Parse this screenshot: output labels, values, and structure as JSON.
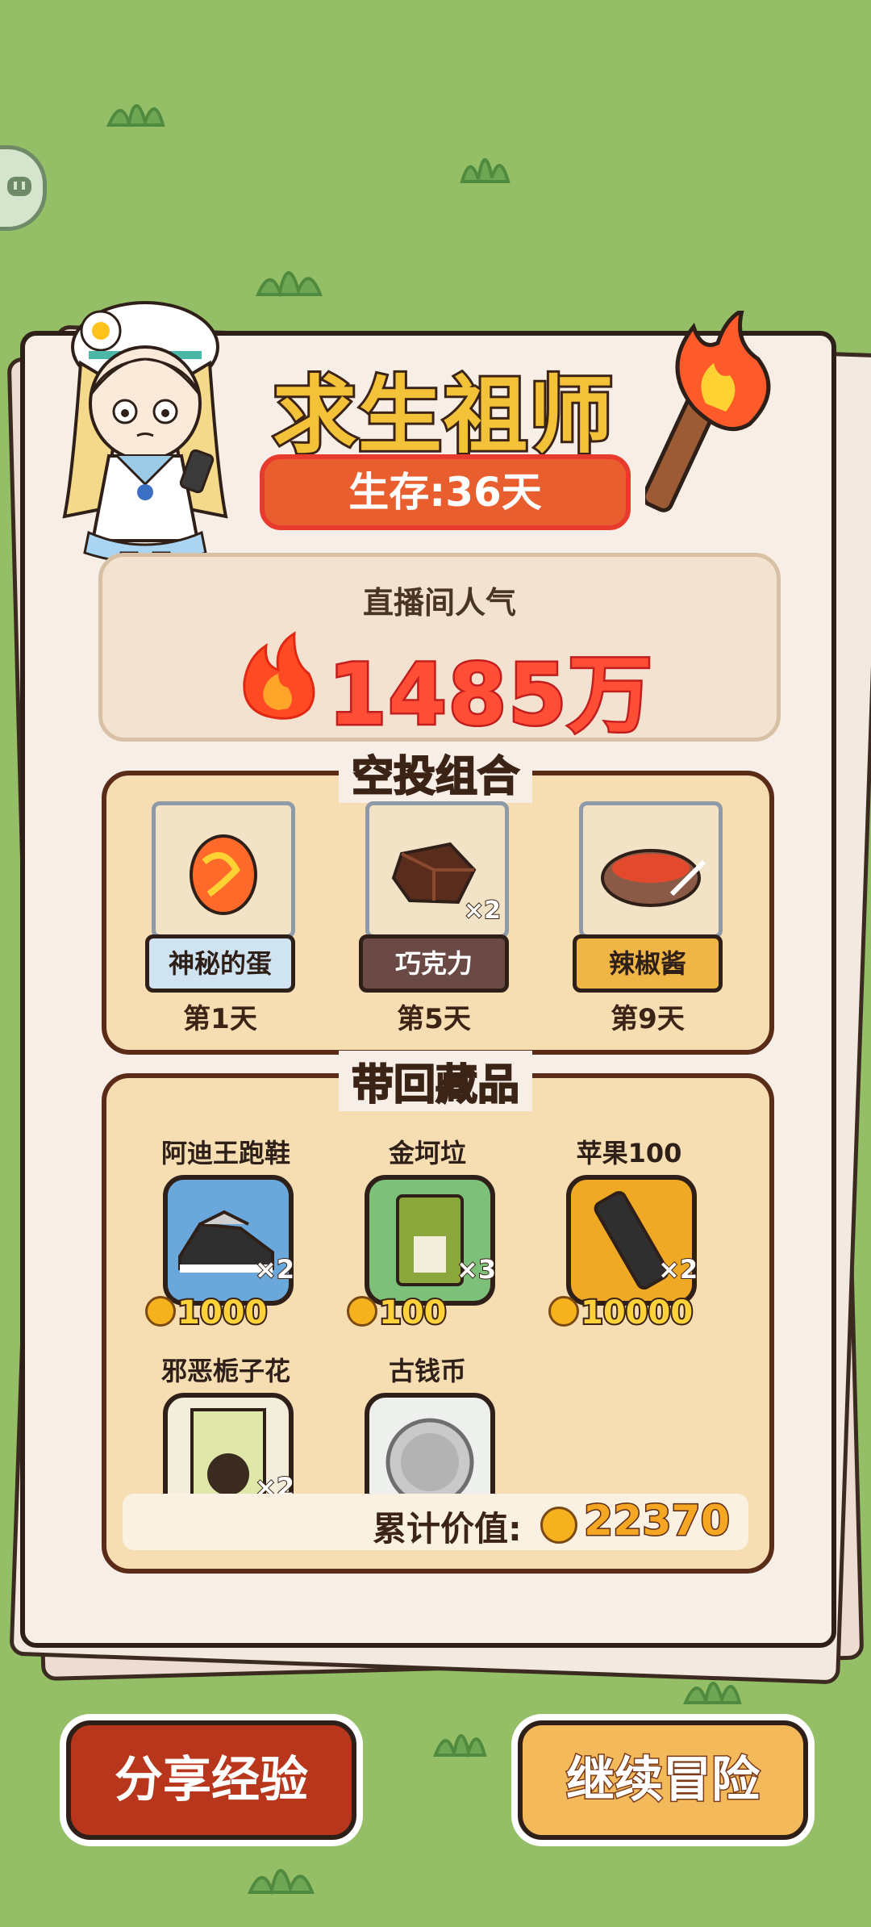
{
  "header": {
    "title": "求生祖师",
    "days_survived": "生存:36天"
  },
  "popularity": {
    "label": "直播间人气",
    "value": "1485万"
  },
  "airdrop": {
    "title": "空投组合",
    "items": [
      {
        "name": "神秘的蛋",
        "day": "第1天",
        "tag_bg": "#cfe3f0",
        "tag_color": "#2e2019"
      },
      {
        "name": "巧克力",
        "day": "第5天",
        "tag_bg": "#6b4a46",
        "tag_color": "#ffffff",
        "qty": "×2"
      },
      {
        "name": "辣椒酱",
        "day": "第9天",
        "tag_bg": "#efb545",
        "tag_color": "#2e2019"
      }
    ]
  },
  "collection": {
    "title": "带回藏品",
    "items": [
      {
        "name": "阿迪王跑鞋",
        "qty": "×2",
        "price": "1000",
        "card_bg": "#6aa8dc"
      },
      {
        "name": "金坷垃",
        "qty": "×3",
        "price": "100",
        "card_bg": "#7cc07a"
      },
      {
        "name": "苹果100",
        "qty": "×2",
        "price": "10000",
        "card_bg": "#f0a925"
      },
      {
        "name": "邪恶栀子花",
        "qty": "×2",
        "card_bg": "#f3eedc"
      },
      {
        "name": "古钱币",
        "card_bg": "#eef0ee"
      }
    ],
    "total_label": "累计价值:",
    "total_value": "22370"
  },
  "buttons": {
    "share": "分享经验",
    "continue": "继续冒险"
  },
  "colors": {
    "background": "#94bf67",
    "share_button": "#b8361b",
    "continue_button": "#f3b95a"
  }
}
